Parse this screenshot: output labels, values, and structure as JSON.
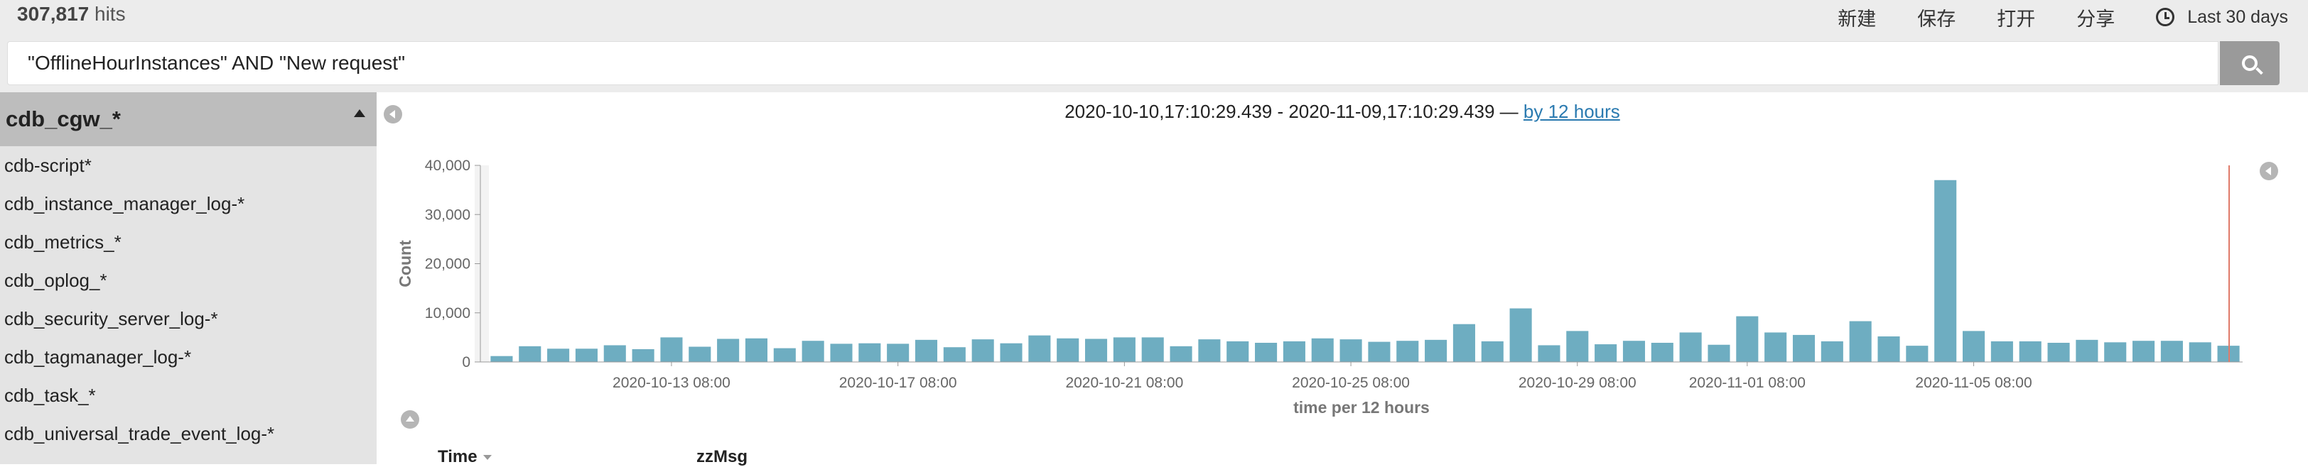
{
  "header": {
    "hits_count": "307,817",
    "hits_label": "hits",
    "actions": [
      "新建",
      "保存",
      "打开",
      "分享"
    ],
    "time_range": "Last 30 days"
  },
  "search": {
    "query": "\"OfflineHourInstances\" AND \"New request\""
  },
  "sidebar": {
    "selected": "cdb_cgw_*",
    "items": [
      "cdb-script*",
      "cdb_instance_manager_log-*",
      "cdb_metrics_*",
      "cdb_oplog_*",
      "cdb_security_server_log-*",
      "cdb_tagmanager_log-*",
      "cdb_task_*",
      "cdb_universal_trade_event_log-*"
    ]
  },
  "main": {
    "range_text": "2020-10-10,17:10:29.439 - 2020-11-09,17:10:29.439 —",
    "interval_link": "by 12 hours",
    "columns": [
      "Time",
      "zzMsg"
    ]
  },
  "colors": {
    "bar": "#6eadc1",
    "marker": "#e07b6a",
    "topbar": "#ececec",
    "sidebar": "#e4e4e4",
    "sidebar_selected": "#bdbdbd"
  },
  "chart_data": {
    "type": "bar",
    "ylabel": "Count",
    "xlabel": "time per 12 hours",
    "ylim": [
      0,
      40000
    ],
    "yticks": [
      0,
      10000,
      20000,
      30000,
      40000
    ],
    "ytick_labels": [
      "0",
      "10,000",
      "20,000",
      "30,000",
      "40,000"
    ],
    "xtick_labels": [
      "2020-10-13 08:00",
      "2020-10-17 08:00",
      "2020-10-21 08:00",
      "2020-10-25 08:00",
      "2020-10-29 08:00",
      "2020-11-01 08:00",
      "2020-11-05 08:00"
    ],
    "xtick_bar_index": [
      6,
      14,
      22,
      30,
      38,
      44,
      52
    ],
    "values": [
      1200,
      3200,
      2700,
      2700,
      3400,
      2600,
      5000,
      3100,
      4700,
      4800,
      2800,
      4300,
      3700,
      3800,
      3700,
      4500,
      3000,
      4600,
      3800,
      5400,
      4800,
      4700,
      5000,
      5000,
      3200,
      4600,
      4200,
      3900,
      4200,
      4800,
      4600,
      4100,
      4300,
      4500,
      7700,
      4200,
      10900,
      3400,
      6300,
      3600,
      4300,
      3900,
      6000,
      3500,
      9300,
      6000,
      5500,
      4200,
      8300,
      5200,
      3300,
      37000,
      6300,
      4200,
      4200,
      3900,
      4500,
      4000,
      4300,
      4300,
      4000,
      3300
    ]
  }
}
